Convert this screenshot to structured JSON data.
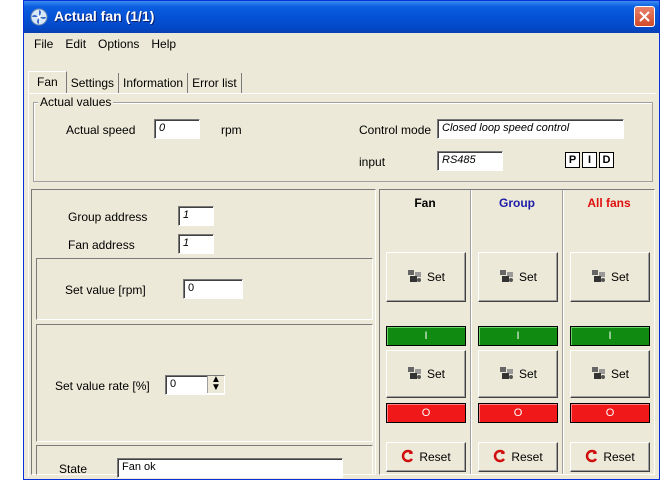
{
  "window": {
    "title": "Actual fan (1/1)"
  },
  "menu": [
    "File",
    "Edit",
    "Options",
    "Help"
  ],
  "tabs": [
    "Fan",
    "Settings",
    "Information",
    "Error list"
  ],
  "actual_values": {
    "legend": "Actual values",
    "speed_label": "Actual speed",
    "speed_value": "0",
    "speed_unit": "rpm",
    "control_mode_label": "Control mode",
    "control_mode_value": "Closed loop speed control",
    "input_label": "input",
    "input_value": "RS485",
    "pid": [
      "P",
      "I",
      "D"
    ]
  },
  "addresses": {
    "group_label": "Group address",
    "group_value": "1",
    "fan_label": "Fan address",
    "fan_value": "1"
  },
  "set_value": {
    "label": "Set value [rpm]",
    "value": "0"
  },
  "set_rate": {
    "label": "Set value rate [%]",
    "value": "0"
  },
  "state": {
    "label": "State",
    "value": "Fan ok"
  },
  "columns": [
    {
      "title": "Fan",
      "color": "#000000",
      "set_label": "Set",
      "on_label": "I",
      "set2_label": "Set",
      "off_label": "O",
      "reset_label": "Reset"
    },
    {
      "title": "Group",
      "color": "#1c1ca8",
      "set_label": "Set",
      "on_label": "I",
      "set2_label": "Set",
      "off_label": "O",
      "reset_label": "Reset"
    },
    {
      "title": "All fans",
      "color": "#e01010",
      "set_label": "Set",
      "on_label": "I",
      "set2_label": "Set",
      "off_label": "O",
      "reset_label": "Reset"
    }
  ],
  "colors": {
    "on_green": "#118a11",
    "off_red": "#f01818",
    "titlebar": "#0452d6"
  }
}
